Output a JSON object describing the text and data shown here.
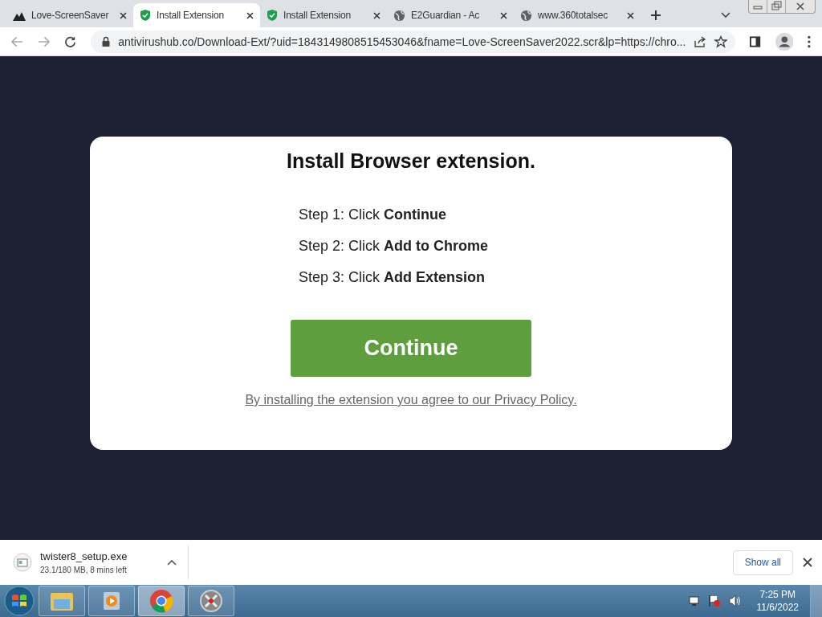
{
  "tabs": [
    {
      "title": "Love-ScreenSaver",
      "kind": "mountain",
      "selected": false
    },
    {
      "title": "Install Extension",
      "kind": "shield",
      "selected": true
    },
    {
      "title": "Install Extension",
      "kind": "shield",
      "selected": false
    },
    {
      "title": "E2Guardian - Ac",
      "kind": "globe",
      "selected": false
    },
    {
      "title": "www.360totalsec",
      "kind": "globe",
      "selected": false
    }
  ],
  "address_bar": {
    "url": "antivirushub.co/Download-Ext/?uid=1843149808515453046&fname=Love-ScreenSaver2022.scr&lp=https://chro..."
  },
  "card": {
    "heading": "Install Browser extension.",
    "steps": [
      "Step 1: Click **Continue**",
      "Step 2: Click **Add to Chrome**",
      "Step 3: Click **Add Extension**"
    ],
    "button": "Continue",
    "policy_link": "By installing the extension you agree to our Privacy Policy."
  },
  "download_bar": {
    "file_name": "twister8_setup.exe",
    "progress": "23.1/180 MB, 8 mins left",
    "show_all": "Show all"
  },
  "taskbar": {
    "apps": [
      {
        "kind": "folder",
        "selected": false
      },
      {
        "kind": "media",
        "selected": false
      },
      {
        "kind": "chrome",
        "selected": true
      },
      {
        "kind": "tool",
        "selected": false
      }
    ],
    "time": "7:25 PM",
    "date": "11/6/2022"
  }
}
